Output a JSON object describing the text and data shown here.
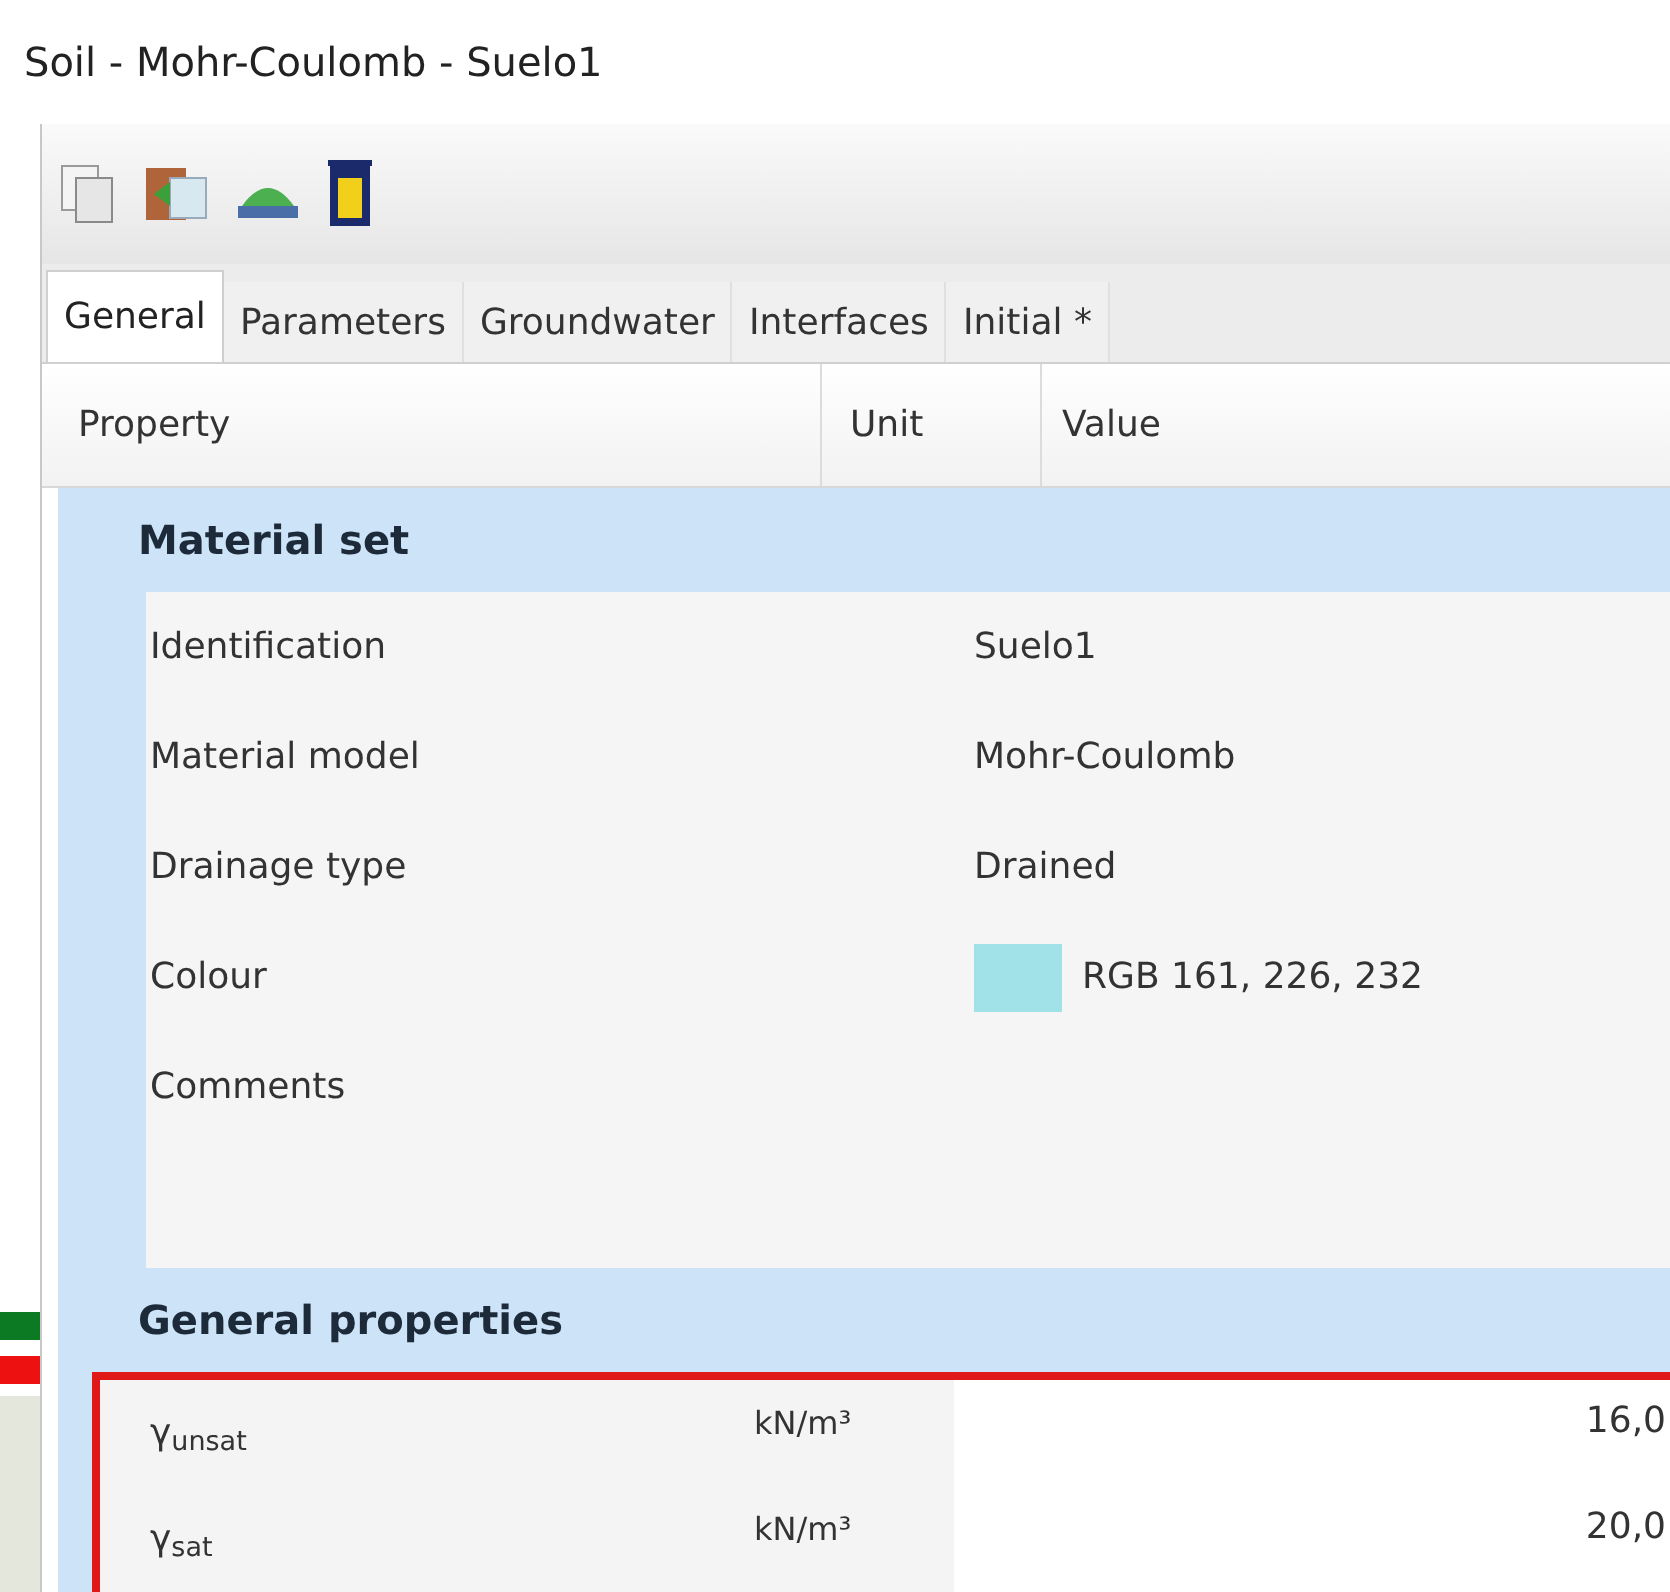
{
  "window": {
    "title": "Soil - Mohr-Coulomb - Suelo1"
  },
  "tabs": [
    {
      "label": "General",
      "selected": true
    },
    {
      "label": "Parameters",
      "selected": false
    },
    {
      "label": "Groundwater",
      "selected": false
    },
    {
      "label": "Interfaces",
      "selected": false
    },
    {
      "label": "Initial *",
      "selected": false
    }
  ],
  "table": {
    "columns": [
      "Property",
      "Unit",
      "Value"
    ],
    "groups": [
      {
        "title": "Material set",
        "highlighted": false,
        "rows": [
          {
            "kind": "text",
            "property": "Identification",
            "value": "Suelo1"
          },
          {
            "kind": "text",
            "property": "Material model",
            "value": "Mohr-Coulomb"
          },
          {
            "kind": "text",
            "property": "Drainage type",
            "value": "Drained"
          },
          {
            "kind": "color",
            "property": "Colour",
            "value": "RGB 161, 226, 232",
            "color": "#a1e2e8"
          },
          {
            "kind": "memo",
            "property": "Comments"
          }
        ]
      },
      {
        "title": "General properties",
        "highlighted": true,
        "rows": [
          {
            "kind": "number",
            "property": "γ$_{unsat}$",
            "unit": "kN/m³",
            "value": "16,0"
          },
          {
            "kind": "number",
            "property": "γ$_{sat}$",
            "unit": "kN/m³",
            "value": "20,0"
          }
        ]
      }
    ]
  }
}
